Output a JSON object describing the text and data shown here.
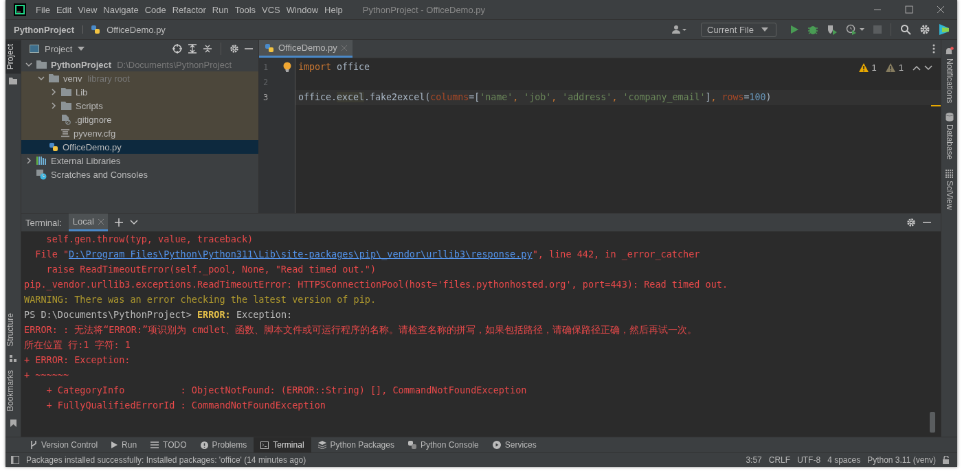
{
  "window": {
    "title": "PythonProject - OfficeDemo.py",
    "menu": [
      "File",
      "Edit",
      "View",
      "Navigate",
      "Code",
      "Refactor",
      "Run",
      "Tools",
      "VCS",
      "Window",
      "Help"
    ]
  },
  "breadcrumb": [
    "PythonProject",
    "OfficeDemo.py"
  ],
  "run_config": "Current File",
  "left_stripe": {
    "top": [
      {
        "label": "Project",
        "selected": true
      }
    ],
    "bottom": [
      {
        "label": "Structure",
        "selected": false
      },
      {
        "label": "Bookmarks",
        "selected": false
      }
    ]
  },
  "project_panel": {
    "title": "Project",
    "tree": [
      {
        "label": "PythonProject",
        "hint": "D:\\Documents\\PythonProject",
        "kind": "folder",
        "bold": true,
        "expanded": true,
        "selected": false,
        "children": [
          {
            "label": "venv",
            "hint": "library root",
            "kind": "folder",
            "expanded": true,
            "library_root": true,
            "selected": false,
            "children": [
              {
                "label": "Lib",
                "kind": "folder",
                "expanded": false,
                "selected": false
              },
              {
                "label": "Scripts",
                "kind": "folder",
                "expanded": false,
                "selected": false
              },
              {
                "label": ".gitignore",
                "kind": "ignored",
                "selected": false
              },
              {
                "label": "pyvenv.cfg",
                "kind": "text",
                "selected": false
              }
            ]
          },
          {
            "label": "OfficeDemo.py",
            "kind": "python",
            "selected": true
          }
        ]
      },
      {
        "label": "External Libraries",
        "kind": "libraries",
        "expanded": false,
        "selected": false
      },
      {
        "label": "Scratches and Consoles",
        "kind": "scratches",
        "selected": false
      }
    ]
  },
  "editor": {
    "tabs": [
      {
        "label": "OfficeDemo.py",
        "selected": true
      }
    ],
    "inspections": [
      {
        "count": "1",
        "kind": "warning"
      },
      {
        "count": "1",
        "kind": "weak"
      }
    ],
    "lines": [
      {
        "number": "1",
        "current": false,
        "tokens": [
          {
            "text": "import",
            "kind": "keyword"
          },
          {
            "text": " office",
            "kind": "plain"
          }
        ]
      },
      {
        "number": "2",
        "current": false
      },
      {
        "number": "3",
        "current": true,
        "tokens": [
          {
            "text": "office.",
            "kind": "plain"
          },
          {
            "text": "excel",
            "kind": "highlight"
          },
          {
            "text": ".fake2excel(",
            "kind": "plain"
          },
          {
            "text": "columns",
            "kind": "param"
          },
          {
            "text": "=[",
            "kind": "plain"
          },
          {
            "text": "'name'",
            "kind": "string"
          },
          {
            "text": ", ",
            "kind": "keyword"
          },
          {
            "text": "'job'",
            "kind": "string"
          },
          {
            "text": ", ",
            "kind": "keyword"
          },
          {
            "text": "'address'",
            "kind": "string"
          },
          {
            "text": ", ",
            "kind": "keyword"
          },
          {
            "text": "'company_email'",
            "kind": "string"
          },
          {
            "text": "]",
            "kind": "plain"
          },
          {
            "text": ", ",
            "kind": "keyword"
          },
          {
            "text": "rows",
            "kind": "param"
          },
          {
            "text": "=",
            "kind": "plain"
          },
          {
            "text": "100",
            "kind": "number"
          },
          {
            "text": ")",
            "kind": "plain"
          }
        ]
      }
    ]
  },
  "right_stripe": [
    "Notifications",
    "Database",
    "SciView"
  ],
  "terminal": {
    "title": "Terminal:",
    "tabs": [
      {
        "label": "Local",
        "selected": true
      }
    ],
    "lines": [
      [
        {
          "text": "    self.gen.throw(typ, value, traceback)",
          "kind": "error"
        }
      ],
      [
        {
          "text": "  File \"",
          "kind": "error"
        },
        {
          "text": "D:\\Program Files\\Python\\Python311\\Lib\\site-packages\\pip\\_vendor\\urllib3\\response.py",
          "kind": "link"
        },
        {
          "text": "\", line 442, in _error_catcher",
          "kind": "error"
        }
      ],
      [
        {
          "text": "    raise ReadTimeoutError(self._pool, None, \"Read timed out.\")",
          "kind": "error"
        }
      ],
      [
        {
          "text": "pip._vendor.urllib3.exceptions.ReadTimeoutError: HTTPSConnectionPool(host='files.pythonhosted.org', port=443): Read timed out.",
          "kind": "error"
        }
      ],
      [
        {
          "text": "WARNING: There was an error checking the latest version of pip.",
          "kind": "warning"
        }
      ],
      [
        {
          "text": "PS D:\\Documents\\PythonProject> ",
          "kind": "normal"
        },
        {
          "text": "ERROR:",
          "kind": "command"
        },
        {
          "text": " Exception:",
          "kind": "normal"
        }
      ],
      [
        {
          "text": "ERROR: : 无法将“ERROR:”项识别为 cmdlet、函数、脚本文件或可运行程序的名称。请检查名称的拼写，如果包括路径，请确保路径正确，然后再试一次。",
          "kind": "error"
        }
      ],
      [
        {
          "text": "所在位置 行:1 字符: 1",
          "kind": "error"
        }
      ],
      [
        {
          "text": "+ ERROR: Exception:",
          "kind": "error"
        }
      ],
      [
        {
          "text": "+ ~~~~~~",
          "kind": "error"
        }
      ],
      [
        {
          "text": "    + CategoryInfo          : ObjectNotFound: (ERROR::String) [], CommandNotFoundException",
          "kind": "error"
        }
      ],
      [
        {
          "text": "    + FullyQualifiedErrorId : CommandNotFoundException",
          "kind": "error"
        }
      ]
    ]
  },
  "tool_tabs": [
    {
      "label": "Version Control",
      "kind": "vcs",
      "selected": false
    },
    {
      "label": "Run",
      "kind": "run",
      "selected": false
    },
    {
      "label": "TODO",
      "kind": "todo",
      "selected": false
    },
    {
      "label": "Problems",
      "kind": "problems",
      "selected": false
    },
    {
      "label": "Terminal",
      "kind": "terminal",
      "selected": true
    },
    {
      "label": "Python Packages",
      "kind": "packages",
      "selected": false
    },
    {
      "label": "Python Console",
      "kind": "console",
      "selected": false
    },
    {
      "label": "Services",
      "kind": "services",
      "selected": false
    }
  ],
  "status_bar": {
    "message": "Packages installed successfully: Installed packages: 'office' (14 minutes ago)",
    "items": [
      "3:57",
      "CRLF",
      "UTF-8",
      "4 spaces",
      "Python 3.11 (venv)"
    ]
  }
}
